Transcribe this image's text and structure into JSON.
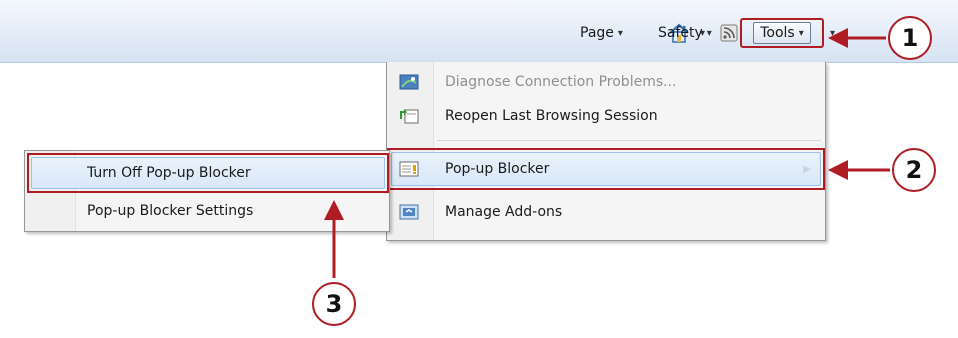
{
  "toolbar": {
    "home_icon": "home-icon",
    "feeds_icon": "rss-feed-icon",
    "mail_icon": "mail-icon",
    "print_icon": "printer-icon",
    "page_label": "Page",
    "safety_label": "Safety",
    "tools_label": "Tools",
    "caret": "▾"
  },
  "tools_menu": {
    "items": [
      {
        "label": "Diagnose Connection Problems...",
        "icon": "diagnose-icon",
        "disabled": true
      },
      {
        "label": "Reopen Last Browsing Session",
        "icon": "reopen-session-icon",
        "disabled": false
      },
      {
        "label": "Pop-up Blocker",
        "icon": "popup-blocker-icon",
        "disabled": false,
        "has_submenu": true
      },
      {
        "label": "Manage Add-ons",
        "icon": "addons-icon",
        "disabled": false
      }
    ]
  },
  "popup_submenu": {
    "items": [
      {
        "label": "Turn Off Pop-up Blocker"
      },
      {
        "label": "Pop-up Blocker Settings"
      }
    ]
  },
  "callouts": {
    "one": "1",
    "two": "2",
    "three": "3"
  },
  "colors": {
    "callout_red": "#b01c24",
    "toolbar_blue": "#dde7f4",
    "highlight_blue": "#d8e7f8"
  }
}
